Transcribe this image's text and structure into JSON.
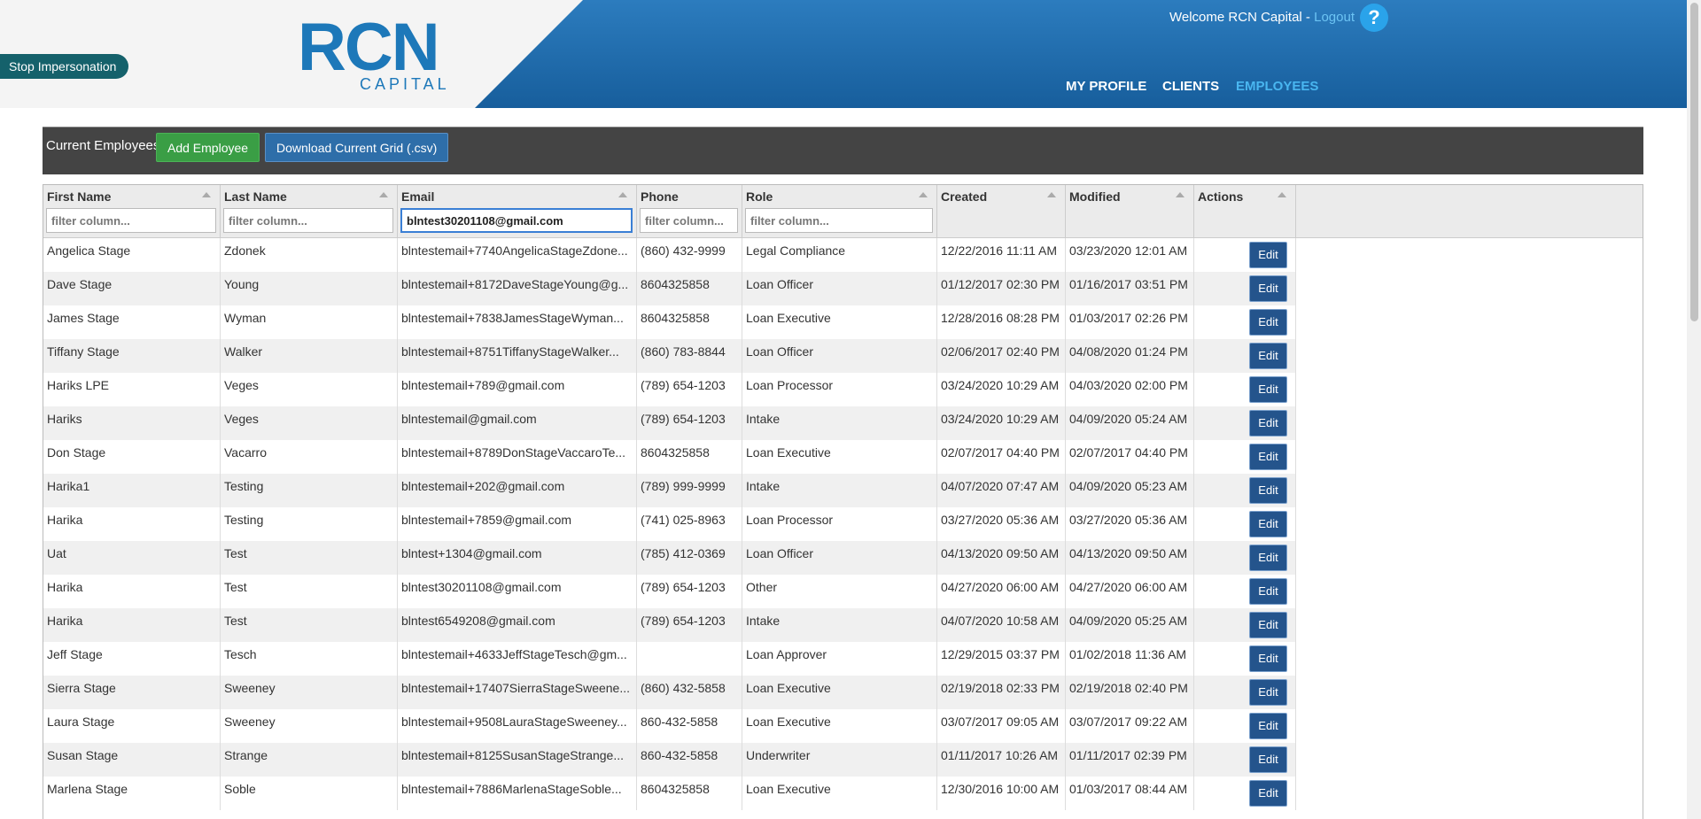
{
  "header": {
    "stop_impersonation": "Stop Impersonation",
    "logo_main": "RCN",
    "logo_sub": "CAPITAL",
    "welcome_text": "Welcome RCN Capital - ",
    "logout": "Logout",
    "help": "?",
    "nav": [
      {
        "label": "MY PROFILE",
        "active": false
      },
      {
        "label": "CLIENTS",
        "active": false
      },
      {
        "label": "EMPLOYEES",
        "active": true
      }
    ]
  },
  "toolbar": {
    "title": "Current Employees",
    "add_label": "Add Employee",
    "download_label": "Download Current Grid (.csv)"
  },
  "grid": {
    "columns": [
      {
        "label": "First Name",
        "filter_placeholder": "filter column...",
        "filter_value": ""
      },
      {
        "label": "Last Name",
        "filter_placeholder": "filter column...",
        "filter_value": ""
      },
      {
        "label": "Email",
        "filter_placeholder": "filter column...",
        "filter_value": "blntest30201108@gmail.com"
      },
      {
        "label": "Phone",
        "filter_placeholder": "filter column...",
        "filter_value": ""
      },
      {
        "label": "Role",
        "filter_placeholder": "filter column...",
        "filter_value": ""
      },
      {
        "label": "Created"
      },
      {
        "label": "Modified"
      },
      {
        "label": "Actions"
      }
    ],
    "edit_label": "Edit",
    "rows": [
      {
        "first": "Angelica Stage",
        "last": "Zdonek",
        "email": "blntestemail+7740AngelicaStageZdone...",
        "phone": "(860) 432-9999",
        "role": "Legal Compliance",
        "created": "12/22/2016 11:11 AM",
        "modified": "03/23/2020 12:01 AM"
      },
      {
        "first": "Dave Stage",
        "last": "Young",
        "email": "blntestemail+8172DaveStageYoung@g...",
        "phone": "8604325858",
        "role": "Loan Officer",
        "created": "01/12/2017 02:30 PM",
        "modified": "01/16/2017 03:51 PM"
      },
      {
        "first": "James Stage",
        "last": "Wyman",
        "email": "blntestemail+7838JamesStageWyman...",
        "phone": "8604325858",
        "role": "Loan Executive",
        "created": "12/28/2016 08:28 PM",
        "modified": "01/03/2017 02:26 PM"
      },
      {
        "first": "Tiffany Stage",
        "last": "Walker",
        "email": "blntestemail+8751TiffanyStageWalker...",
        "phone": "(860) 783-8844",
        "role": "Loan Officer",
        "created": "02/06/2017 02:40 PM",
        "modified": "04/08/2020 01:24 PM"
      },
      {
        "first": "Hariks LPE",
        "last": "Veges",
        "email": "blntestemail+789@gmail.com",
        "phone": "(789) 654-1203",
        "role": "Loan Processor",
        "created": "03/24/2020 10:29 AM",
        "modified": "04/03/2020 02:00 PM"
      },
      {
        "first": "Hariks",
        "last": "Veges",
        "email": "blntestemail@gmail.com",
        "phone": "(789) 654-1203",
        "role": "Intake",
        "created": "03/24/2020 10:29 AM",
        "modified": "04/09/2020 05:24 AM"
      },
      {
        "first": "Don Stage",
        "last": "Vacarro",
        "email": "blntestemail+8789DonStageVaccaroTe...",
        "phone": "8604325858",
        "role": "Loan Executive",
        "created": "02/07/2017 04:40 PM",
        "modified": "02/07/2017 04:40 PM"
      },
      {
        "first": "Harika1",
        "last": "Testing",
        "email": "blntestemail+202@gmail.com",
        "phone": "(789) 999-9999",
        "role": "Intake",
        "created": "04/07/2020 07:47 AM",
        "modified": "04/09/2020 05:23 AM"
      },
      {
        "first": "Harika",
        "last": "Testing",
        "email": "blntestemail+7859@gmail.com",
        "phone": "(741) 025-8963",
        "role": "Loan Processor",
        "created": "03/27/2020 05:36 AM",
        "modified": "03/27/2020 05:36 AM"
      },
      {
        "first": "Uat",
        "last": "Test",
        "email": "blntest+1304@gmail.com",
        "phone": "(785) 412-0369",
        "role": "Loan Officer",
        "created": "04/13/2020 09:50 AM",
        "modified": "04/13/2020 09:50 AM"
      },
      {
        "first": "Harika",
        "last": "Test",
        "email": "blntest30201108@gmail.com",
        "phone": "(789) 654-1203",
        "role": "Other",
        "created": "04/27/2020 06:00 AM",
        "modified": "04/27/2020 06:00 AM"
      },
      {
        "first": "Harika",
        "last": "Test",
        "email": "blntest6549208@gmail.com",
        "phone": "(789) 654-1203",
        "role": "Intake",
        "created": "04/07/2020 10:58 AM",
        "modified": "04/09/2020 05:25 AM"
      },
      {
        "first": "Jeff Stage",
        "last": "Tesch",
        "email": "blntestemail+4633JeffStageTesch@gm...",
        "phone": "",
        "role": "Loan Approver",
        "created": "12/29/2015 03:37 PM",
        "modified": "01/02/2018 11:36 AM"
      },
      {
        "first": "Sierra Stage",
        "last": "Sweeney",
        "email": "blntestemail+17407SierraStageSweene...",
        "phone": "(860) 432-5858",
        "role": "Loan Executive",
        "created": "02/19/2018 02:33 PM",
        "modified": "02/19/2018 02:40 PM"
      },
      {
        "first": "Laura Stage",
        "last": "Sweeney",
        "email": "blntestemail+9508LauraStageSweeney...",
        "phone": "860-432-5858",
        "role": "Loan Executive",
        "created": "03/07/2017 09:05 AM",
        "modified": "03/07/2017 09:22 AM"
      },
      {
        "first": "Susan Stage",
        "last": "Strange",
        "email": "blntestemail+8125SusanStageStrange...",
        "phone": "860-432-5858",
        "role": "Underwriter",
        "created": "01/11/2017 10:26 AM",
        "modified": "01/11/2017 02:39 PM"
      },
      {
        "first": "Marlena Stage",
        "last": "Soble",
        "email": "blntestemail+7886MarlenaStageSoble...",
        "phone": "8604325858",
        "role": "Loan Executive",
        "created": "12/30/2016 10:00 AM",
        "modified": "01/03/2017 08:44 AM"
      }
    ]
  },
  "colors": {
    "header_blue": "#175e9c",
    "logo_blue": "#1d78b9",
    "nav_active": "#49b6f0",
    "add_green": "#3a9e45",
    "download_blue": "#2e6ea9",
    "edit_blue": "#24548c",
    "toolbar_dark": "#444444"
  }
}
